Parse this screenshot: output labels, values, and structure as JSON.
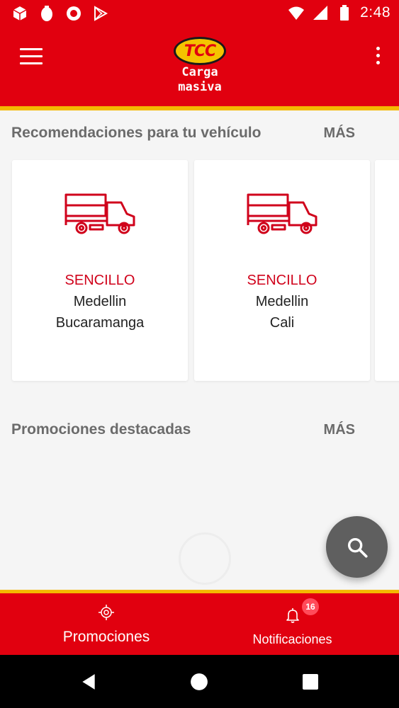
{
  "status_bar": {
    "time": "2:48",
    "left_icons": [
      "box-icon",
      "egg-icon",
      "record-icon",
      "play-store-icon"
    ],
    "right_icons": [
      "wifi-icon",
      "signal-icon",
      "battery-icon"
    ]
  },
  "app_bar": {
    "logo_text": "TCC",
    "subtitle_line1": "Carga",
    "subtitle_line2": "masiva",
    "menu_icon": "hamburger-menu-icon",
    "more_icon": "more-vert-icon"
  },
  "recommendations": {
    "title": "Recomendaciones para tu vehículo",
    "more_label": "MÁS",
    "cards": [
      {
        "type": "SENCILLO",
        "origin": "Medellin",
        "destination": "Bucaramanga",
        "icon": "truck-icon"
      },
      {
        "type": "SENCILLO",
        "origin": "Medellin",
        "destination": "Cali",
        "icon": "truck-icon"
      }
    ]
  },
  "promotions": {
    "title": "Promociones destacadas",
    "more_label": "MÁS"
  },
  "fab": {
    "icon": "search-icon"
  },
  "bottom_nav": {
    "promos_label": "Promociones",
    "promos_icon": "target-icon",
    "notifications_label": "Notificaciones",
    "notifications_icon": "bell-icon",
    "notifications_badge": "16"
  },
  "colors": {
    "primary_red": "#e1000f",
    "accent_yellow": "#f4b800",
    "fab_gray": "#5f5f5f",
    "card_type_red": "#d0021b"
  }
}
